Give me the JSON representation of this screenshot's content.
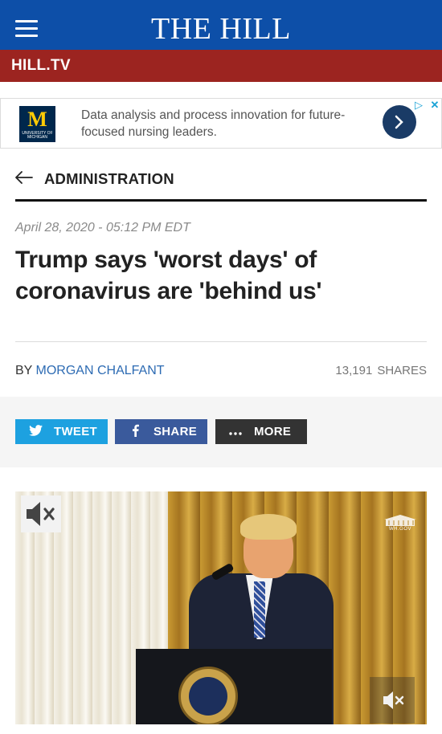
{
  "header": {
    "brand": "THE HILL",
    "menu_icon": "hamburger-menu-icon"
  },
  "subnav": {
    "label": "HILL.TV"
  },
  "ad": {
    "logo_letter": "M",
    "logo_subtext": "UNIVERSITY OF MICHIGAN",
    "text": "Data analysis and process innovation for future-focused nursing leaders.",
    "arrow_icon": "chevron-right-icon",
    "adchoices_icon": "ad-choices-icon",
    "close_icon": "close-icon"
  },
  "article": {
    "section": "ADMINISTRATION",
    "back_icon": "arrow-left-icon",
    "date": "April 28, 2020 - 05:12 PM EDT",
    "headline": "Trump says 'worst days' of coronavirus are 'behind us'",
    "by_prefix": "BY",
    "author": "MORGAN CHALFANT",
    "shares_count": "13,191",
    "shares_label": "SHARES"
  },
  "share_buttons": {
    "tweet": "TWEET",
    "share": "SHARE",
    "more": "MORE"
  },
  "video": {
    "watermark": "WH.GOV",
    "mute_icon": "speaker-muted-icon"
  },
  "colors": {
    "header_blue": "#0d4fa8",
    "hilltv_red": "#9c2420",
    "tweet_blue": "#1da1e0",
    "facebook_blue": "#3a5a9c",
    "more_dark": "#333333",
    "author_link": "#2d6bb3"
  }
}
